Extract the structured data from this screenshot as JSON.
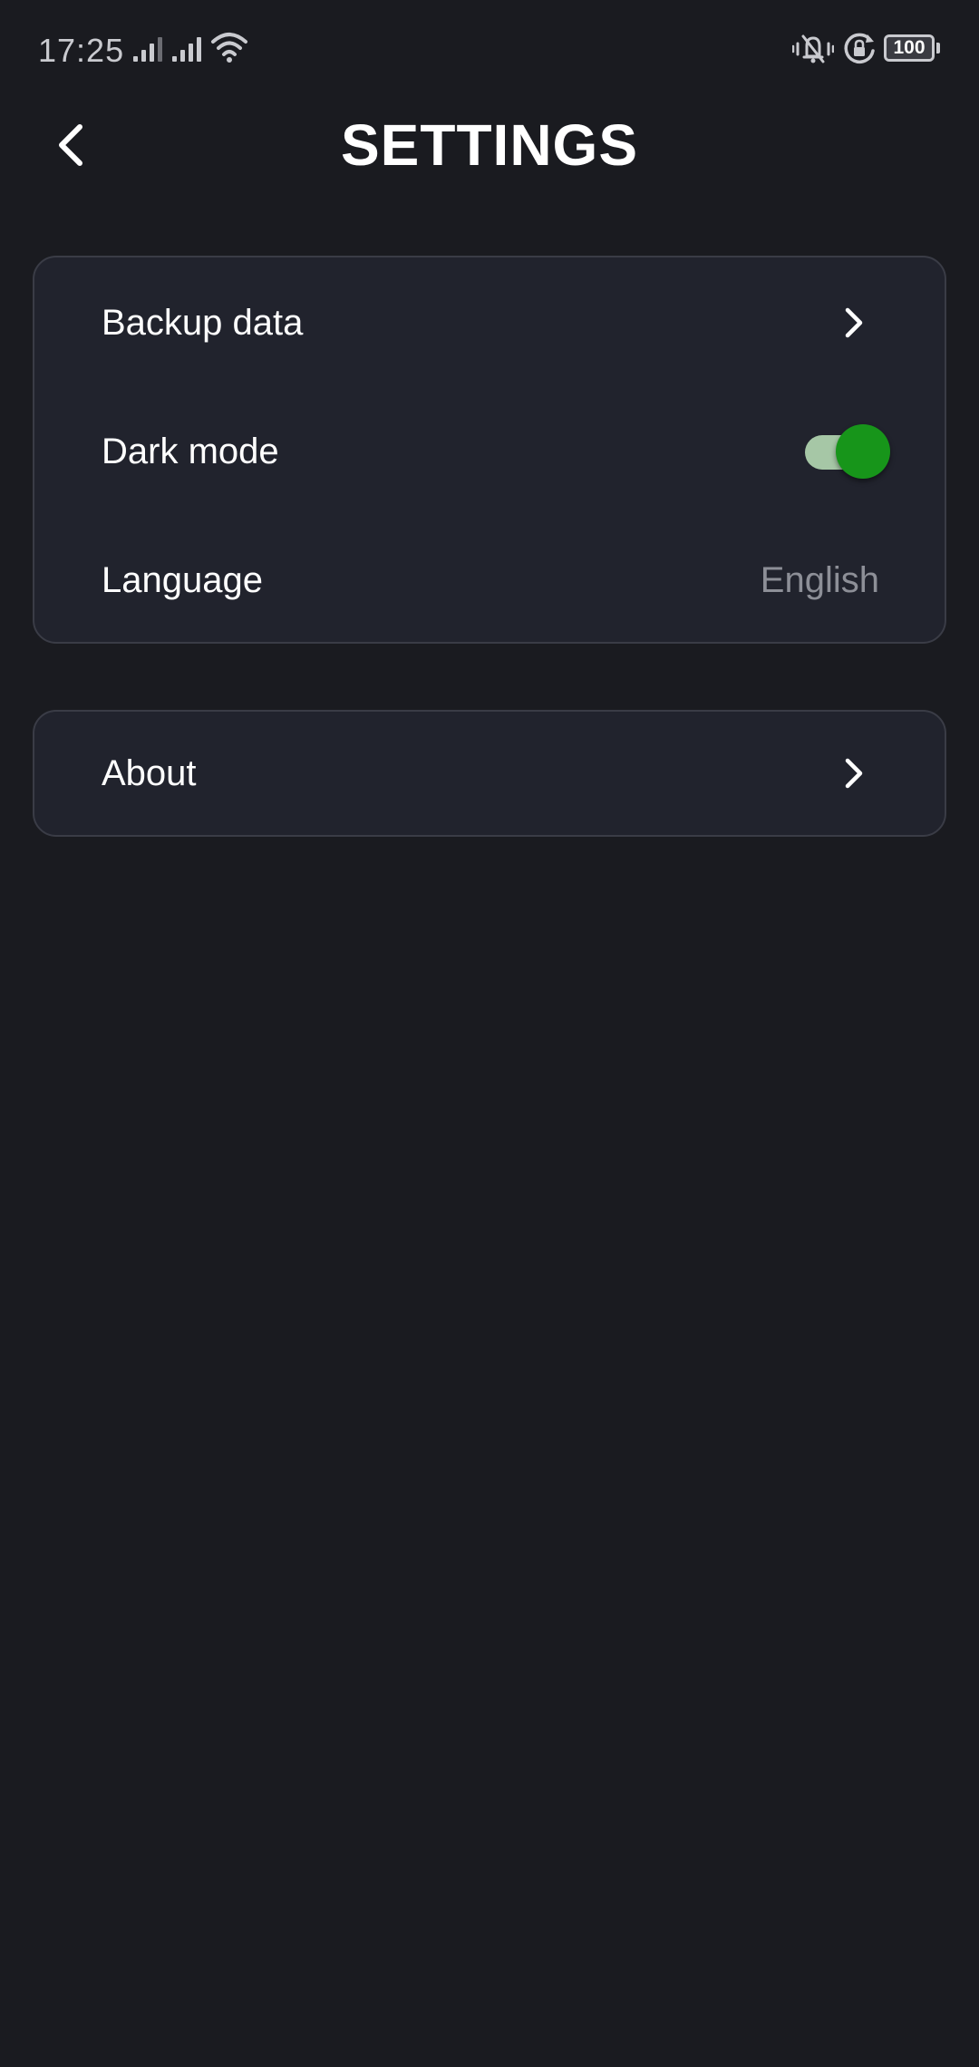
{
  "status_bar": {
    "time": "17:25",
    "battery_level": "100",
    "icons": [
      "signal-icon",
      "signal-icon",
      "wifi-icon",
      "vibrate-icon",
      "rotation-lock-icon",
      "battery-icon"
    ]
  },
  "header": {
    "title": "SETTINGS",
    "back_icon": "chevron-left-icon"
  },
  "settings_group_1": {
    "items": [
      {
        "label": "Backup data",
        "trailing": "chevron-right-icon"
      },
      {
        "label": "Dark mode",
        "trailing": "toggle",
        "toggle_on": true
      },
      {
        "label": "Language",
        "value": "English"
      }
    ]
  },
  "settings_group_2": {
    "items": [
      {
        "label": "About",
        "trailing": "chevron-right-icon"
      }
    ]
  },
  "colors": {
    "background": "#1a1b20",
    "card": "#21232d",
    "card_border": "#3a3c46",
    "toggle_thumb": "#17951a",
    "toggle_track": "#a6c7a6",
    "secondary_text": "#8d8f97"
  }
}
